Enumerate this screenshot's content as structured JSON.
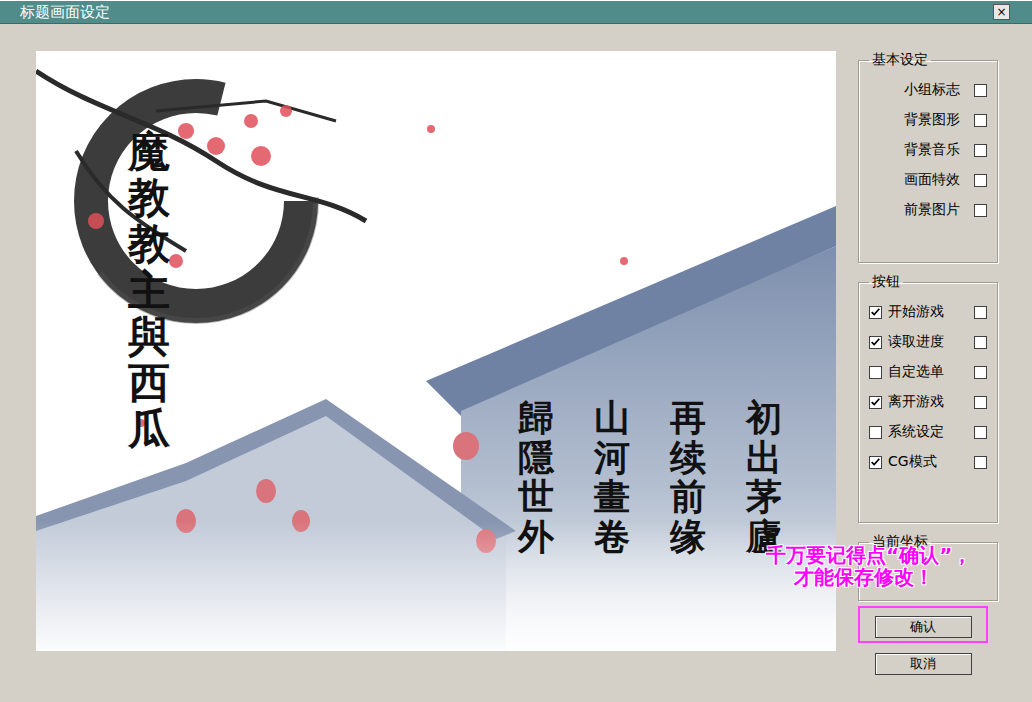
{
  "window": {
    "title": "标题画面设定",
    "close": "×"
  },
  "preview": {
    "title": "魔教教主與西瓜",
    "menu": [
      "初出茅廬",
      "再续前缘",
      "山河畫卷",
      "歸隱世外"
    ]
  },
  "basic": {
    "legend": "基本设定",
    "items": [
      {
        "label": "小组标志",
        "checked": false
      },
      {
        "label": "背景图形",
        "checked": false
      },
      {
        "label": "背景音乐",
        "checked": false
      },
      {
        "label": "画面特效",
        "checked": false
      },
      {
        "label": "前景图片",
        "checked": false
      }
    ]
  },
  "buttons_group": {
    "legend": "按钮",
    "items": [
      {
        "label": "开始游戏",
        "enabled": true,
        "checked": false
      },
      {
        "label": "读取进度",
        "enabled": true,
        "checked": false
      },
      {
        "label": "自定选单",
        "enabled": false,
        "checked": false
      },
      {
        "label": "离开游戏",
        "enabled": true,
        "checked": false
      },
      {
        "label": "系统设定",
        "enabled": false,
        "checked": false
      },
      {
        "label": "CG模式",
        "enabled": true,
        "checked": false
      }
    ]
  },
  "coords": {
    "legend": "当前坐标"
  },
  "annotation": [
    "千万要记得点“确认”，",
    "才能保存修改！"
  ],
  "actions": [
    {
      "label": "确认",
      "highlighted": true
    },
    {
      "label": "取消",
      "highlighted": false
    }
  ]
}
